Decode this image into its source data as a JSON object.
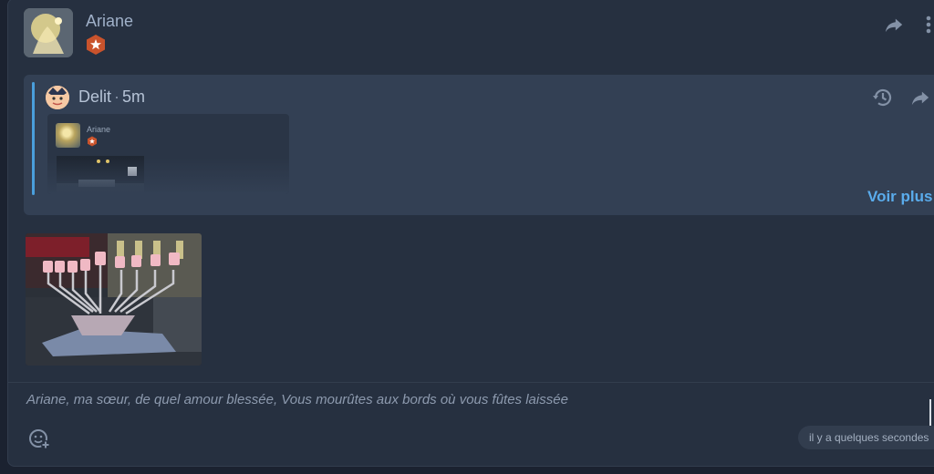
{
  "post": {
    "author": "Ariane",
    "avatar_icon": "ariane-avatar-image",
    "badge_icon": "star-hexagon-badge-icon",
    "share_icon": "share-arrow-icon",
    "more_icon": "more-vertical-icon"
  },
  "quote": {
    "author": "Delit",
    "separator": "·",
    "time": "5m",
    "history_icon": "history-icon",
    "share_icon": "share-arrow-icon",
    "preview": {
      "author": "Ariane"
    },
    "voir_plus": "Voir plus"
  },
  "attachment": {
    "image_icon": "menorah-photo"
  },
  "comment": {
    "text": "Ariane, ma sœur, de quel amour blessée, Vous mourûtes aux bords où vous fûtes laissée",
    "emoji_icon": "add-reaction-icon"
  },
  "timestamp": "il y a quelques secondes",
  "colors": {
    "accent": "#5aacec",
    "badge": "#c9532c",
    "background": "#263040",
    "quote_background": "#334054"
  }
}
